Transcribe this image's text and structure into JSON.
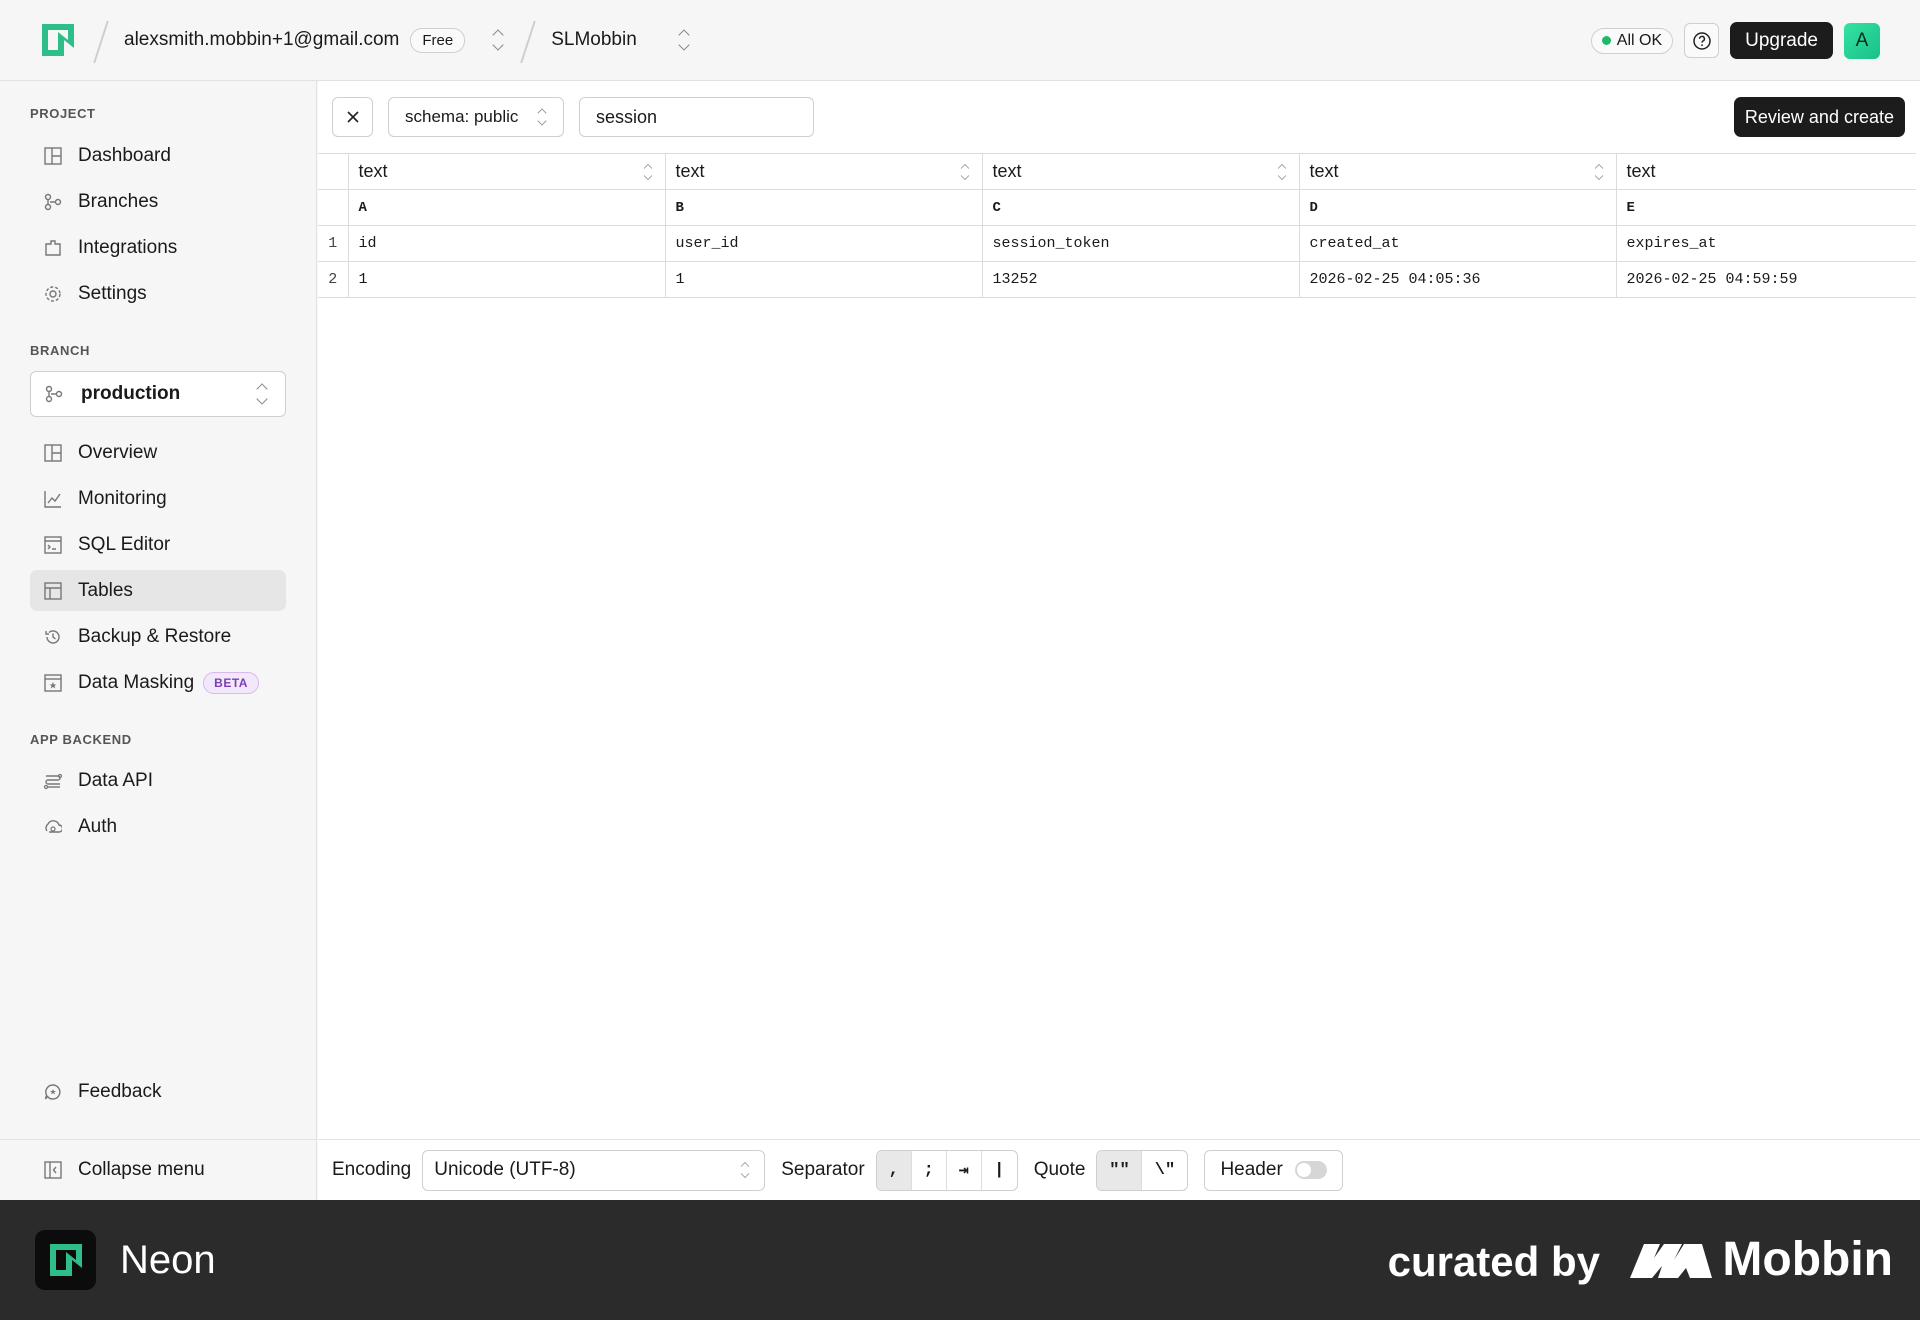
{
  "topbar": {
    "account": "alexsmith.mobbin+1@gmail.com",
    "plan": "Free",
    "project": "SLMobbin",
    "status": "All OK",
    "upgrade": "Upgrade",
    "avatar_letter": "A"
  },
  "sidebar": {
    "project_heading": "PROJECT",
    "project_items": [
      {
        "label": "Dashboard",
        "icon": "dashboard-icon"
      },
      {
        "label": "Branches",
        "icon": "branches-icon"
      },
      {
        "label": "Integrations",
        "icon": "integrations-icon"
      },
      {
        "label": "Settings",
        "icon": "gear-icon"
      }
    ],
    "branch_heading": "BRANCH",
    "branch_selected": "production",
    "branch_items": [
      {
        "label": "Overview",
        "icon": "overview-icon"
      },
      {
        "label": "Monitoring",
        "icon": "chart-icon"
      },
      {
        "label": "SQL Editor",
        "icon": "terminal-icon"
      },
      {
        "label": "Tables",
        "icon": "table-icon",
        "active": true
      },
      {
        "label": "Backup & Restore",
        "icon": "history-icon"
      },
      {
        "label": "Data Masking",
        "icon": "mask-icon",
        "badge": "BETA"
      }
    ],
    "backend_heading": "APP BACKEND",
    "backend_items": [
      {
        "label": "Data API",
        "icon": "api-icon"
      },
      {
        "label": "Auth",
        "icon": "auth-icon"
      }
    ],
    "feedback": "Feedback",
    "collapse": "Collapse menu"
  },
  "toolbar": {
    "schema": "schema: public",
    "table_name": "session",
    "review": "Review and create"
  },
  "grid": {
    "types": [
      "text",
      "text",
      "text",
      "text",
      "text"
    ],
    "letters": [
      "A",
      "B",
      "C",
      "D",
      "E"
    ],
    "rows": [
      {
        "num": "1",
        "cells": [
          "id",
          "user_id",
          "session_token",
          "created_at",
          "expires_at"
        ]
      },
      {
        "num": "2",
        "cells": [
          "1",
          "1",
          "13252",
          "2026-02-25 04:05:36",
          "2026-02-25 04:59:59"
        ]
      }
    ]
  },
  "options": {
    "encoding_label": "Encoding",
    "encoding_value": "Unicode (UTF-8)",
    "separator_label": "Separator",
    "separators": [
      ",",
      ";",
      "⇥",
      "|"
    ],
    "quote_label": "Quote",
    "quotes": [
      "\"\"",
      "\\\""
    ],
    "header_label": "Header"
  },
  "footer": {
    "brand": "Neon",
    "curated": "curated by",
    "mobbin": "Mobbin"
  },
  "colors": {
    "accent": "#1db96c",
    "dark": "#1c1c1c",
    "footer_bg": "#2b2b2b",
    "beta": "#7a3fb3"
  }
}
